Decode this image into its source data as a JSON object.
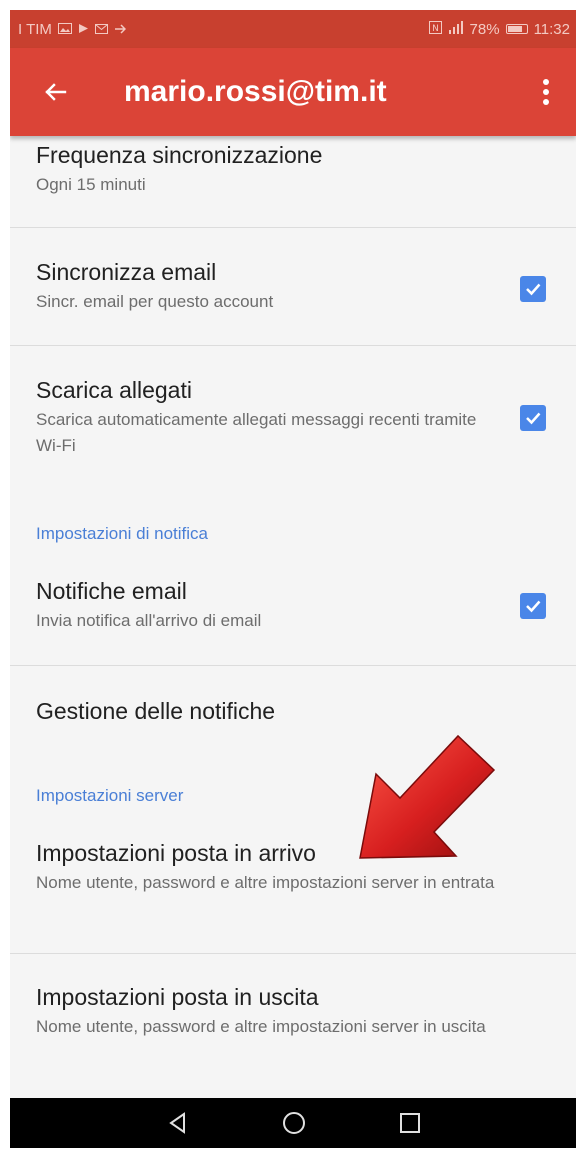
{
  "status_bar": {
    "carrier": "I TIM",
    "battery_percent": "78%",
    "battery_level": 0.78,
    "time": "11:32",
    "left_icons": [
      "gallery-icon",
      "play-icon",
      "mail-icon",
      "cast-icon"
    ],
    "right_icons": [
      "nfc-icon",
      "signal-icon"
    ]
  },
  "app_bar": {
    "title": "mario.rossi@tim.it",
    "background_color": "#db4437",
    "back_icon": "arrow-left-icon",
    "menu_icon": "more-vert-icon"
  },
  "settings": {
    "sync_frequency": {
      "title": "Frequenza sincronizzazione",
      "subtitle": "Ogni 15 minuti"
    },
    "sync_email": {
      "title": "Sincronizza email",
      "subtitle": "Sincr. email per questo account",
      "checked": true
    },
    "download_attachments": {
      "title": "Scarica allegati",
      "subtitle": "Scarica automaticamente allegati messaggi recenti tramite Wi-Fi",
      "checked": true
    },
    "notification_section": {
      "header": "Impostazioni di notifica"
    },
    "email_notifications": {
      "title": "Notifiche email",
      "subtitle": "Invia notifica all'arrivo di email",
      "checked": true
    },
    "manage_notifications": {
      "title": "Gestione delle notifiche"
    },
    "server_section": {
      "header": "Impostazioni server"
    },
    "incoming_settings": {
      "title": "Impostazioni posta in arrivo",
      "subtitle": "Nome utente, password e altre impostazioni server in entrata"
    },
    "outgoing_settings": {
      "title": "Impostazioni posta in uscita",
      "subtitle": "Nome utente, password e altre impostazioni server in uscita"
    }
  },
  "accent_color": "#4a86e8",
  "annotation": {
    "icon": "red-arrow-annotation-icon",
    "color": "#d71f1f"
  },
  "nav_bar": {
    "back_icon": "triangle-back-icon",
    "home_icon": "circle-home-icon",
    "recents_icon": "square-recents-icon"
  }
}
